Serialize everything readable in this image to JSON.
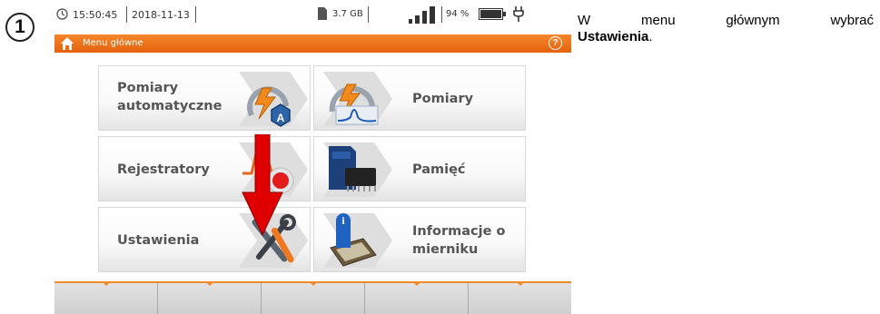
{
  "step": {
    "number": "1"
  },
  "status": {
    "time": "15:50:45",
    "date": "2018-11-13",
    "storage": "3.7 GB",
    "battery": "94 %"
  },
  "titlebar": {
    "title": "Menu główne",
    "help": "?"
  },
  "menu": {
    "auto_line1": "Pomiary",
    "auto_line2": "automatyczne",
    "measurements": "Pomiary",
    "recorders": "Rejestratory",
    "memory": "Pamięć",
    "settings": "Ustawienia",
    "info_line1": "Informacje o",
    "info_line2": "mierniku"
  },
  "instruction": {
    "w1": "W",
    "w2": "menu",
    "w3": "głównym",
    "w4": "wybrać",
    "bold": "Ustawienia",
    "tail": "."
  },
  "colors": {
    "accent": "#e8721c",
    "arrow": "#e00000"
  }
}
